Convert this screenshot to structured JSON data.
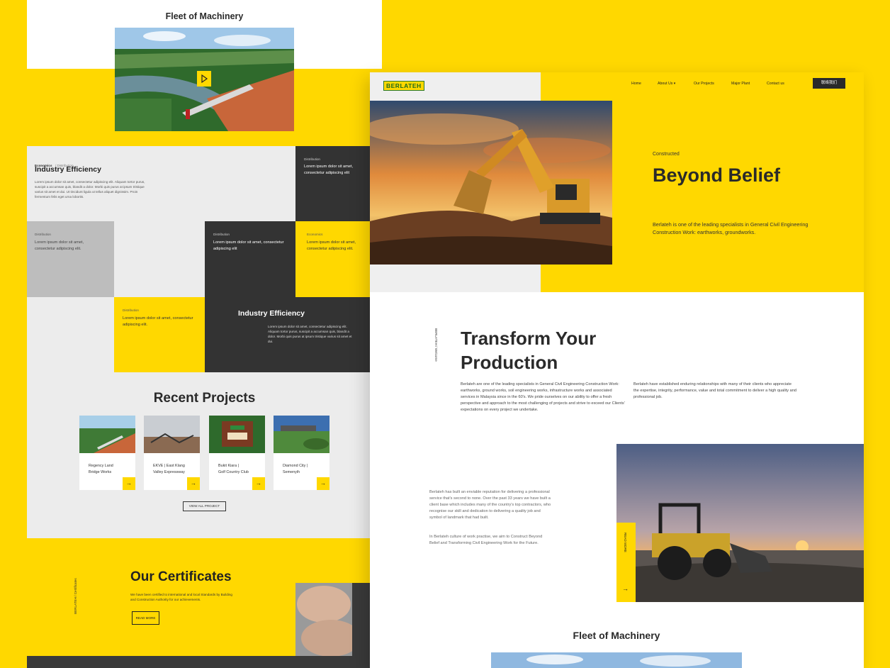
{
  "left": {
    "fleet_title": "Fleet of Machinery",
    "grid": {
      "breadcrumb_a": "Economics",
      "breadcrumb_b": "/ Distribution",
      "heading": "Industry Efficiency",
      "body": "Lorem ipsum dolor sit amet, consectetur adipiscing elit. Aliquam tortor purus, suscipit a accumsan quis, blandit a dolor. Morbi quis purus at ipsum tristique varius sit amet et dui. Ut tincidunt ligula ut tellus aliquet dignissim. Proin fermentum felis eget urna lobortis.",
      "tile_tr_tag": "Distribution",
      "tile_tr_text": "Lorem ipsum dolor sit amet, consectetur adipiscing elit",
      "tile_gray_tag": "Distribution",
      "tile_gray_text": "Lorem ipsum dolor sit amet, consectetur adipiscing elit.",
      "tile_dark_tag": "Distribution",
      "tile_dark_text": "Lorem ipsum dolor sit amet, consectetur adipiscing elit",
      "tile_yellow_tag": "Economics",
      "tile_yellow_text": "Lorem ipsum dolor sit amet, consectetur adipiscing elit.",
      "tile_y2_tag": "Distribution",
      "tile_y2_text": "Lorem ipsum dolor sit amet, consectetur adipiscing elit.",
      "dark_heading": "Industry Efficiency",
      "dark_body": "Lorem ipsum dolor sit amet, consectetur adipiscing elit. Aliquam tortor purus, suscipit a accumsan quis, blandit a dolor. Morbi quis purus at ipsum tristique varius sit amet et dui."
    },
    "recent_projects_title": "Recent Projects",
    "projects": [
      {
        "line1": "Regency Land",
        "line2": "Bridge Works"
      },
      {
        "line1": "EKVE | East Klang",
        "line2": "Valley Expressway"
      },
      {
        "line1": "Bukit Kiara |",
        "line2": "Golf Country Club"
      },
      {
        "line1": "Diamond City |",
        "line2": "Semenyih"
      }
    ],
    "view_all": "VIEW ALL PROJECT",
    "certificates": {
      "side": "BERLATEH / Certificates",
      "title": "Our Certificates",
      "body": "We have been certified to international and local Standards by Building and Construction Authority for our achievements.",
      "button": "READ MORE"
    }
  },
  "right": {
    "logo": "BERLATEH",
    "nav": [
      "Home",
      "About Us ▾",
      "Our Projects",
      "Major Plant",
      "Contact  us"
    ],
    "nav_button": "联络我们",
    "hero": {
      "eyebrow": "Constructed",
      "title": "Beyond Belief",
      "body": "Berlateh is one of the leading specialists in General Civil Engineering Construction Work: earthworks, groundworks."
    },
    "welcome_side": "BERLATEH / Welcome",
    "transform_line1": "Transform Your",
    "transform_line2": "Production",
    "col1": "Berlateh are one of the leading specialists in General Civil Engineering Construction Work: earthworks, ground works, soil engineering works, infrastructure works and associated services in Malaysia since in the 60's. We pride ourselves on our ability to offer a fresh perspective and approach to the most challenging of projects and strive to exceed our Clients' expectations on every project we undertake.",
    "col2": "Berlateh have established enduring relationships with many of their clients who appreciate the expertise, integrity, performance, value and total commitment to deliver a high quality and professional job.",
    "about_p1": "Berlateh has built an enviable reputation for delivering a professional service that's second to none. Over the past 33 years we have built a client base which includes many of the country's top contractors, who recognise our skill and dedication to delivering a quality job and symbol of landmark that had built.",
    "about_p2": "In Berlateh culture of work practise, we aim to Construct Beyond Belief and Transforming Civil Engineering Work for the Future.",
    "read_more_vertical": "READ MORE",
    "fleet_title": "Fleet of Machinery"
  },
  "colors": {
    "brand_yellow": "#FFD800",
    "dark": "#333333",
    "gray": "#bdbdbd",
    "light": "#ececec"
  }
}
